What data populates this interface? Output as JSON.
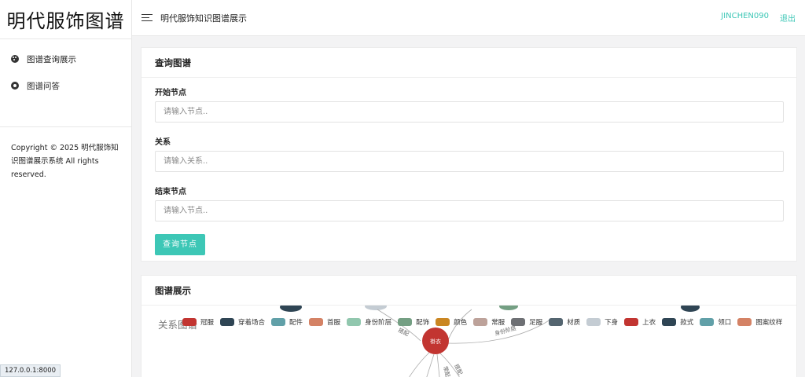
{
  "sidebar": {
    "brand": "明代服饰图谱",
    "items": [
      {
        "label": "图谱查询展示",
        "icon": "palette-icon"
      },
      {
        "label": "图谱问答",
        "icon": "compass-icon"
      }
    ],
    "copyright": "Copyright © 2025 明代服饰知识图谱展示系统 All rights reserved."
  },
  "header": {
    "title": "明代服饰知识图谱展示",
    "user": "JINCHEN090",
    "logout": "退出"
  },
  "query_card": {
    "title": "查询图谱",
    "start_label": "开始节点",
    "start_placeholder": "请输入节点..",
    "relation_label": "关系",
    "relation_placeholder": "请输入关系..",
    "end_label": "结束节点",
    "end_placeholder": "请输入节点..",
    "button": "查询节点"
  },
  "graph_card": {
    "title": "图谱展示",
    "watermark": "关系图谱",
    "center_node": "褂衣",
    "edge_labels": [
      "搭配",
      "身份阶层",
      "常配",
      "搭配"
    ],
    "legend": [
      {
        "label": "冠服",
        "color": "#c23531"
      },
      {
        "label": "穿着场合",
        "color": "#2f4554"
      },
      {
        "label": "配件",
        "color": "#61a0a8"
      },
      {
        "label": "首服",
        "color": "#d48265"
      },
      {
        "label": "身份阶层",
        "color": "#91c7ae"
      },
      {
        "label": "配饰",
        "color": "#749f83"
      },
      {
        "label": "颜色",
        "color": "#ca8622"
      },
      {
        "label": "常服",
        "color": "#bda29a"
      },
      {
        "label": "足服",
        "color": "#6e7074"
      },
      {
        "label": "材质",
        "color": "#546570"
      },
      {
        "label": "下身",
        "color": "#c4ccd3"
      },
      {
        "label": "上衣",
        "color": "#c23531"
      },
      {
        "label": "款式",
        "color": "#2f4554"
      },
      {
        "label": "领口",
        "color": "#61a0a8"
      },
      {
        "label": "图案纹样",
        "color": "#d48265"
      }
    ]
  },
  "statusbar": {
    "url": "127.0.0.1:8000"
  }
}
